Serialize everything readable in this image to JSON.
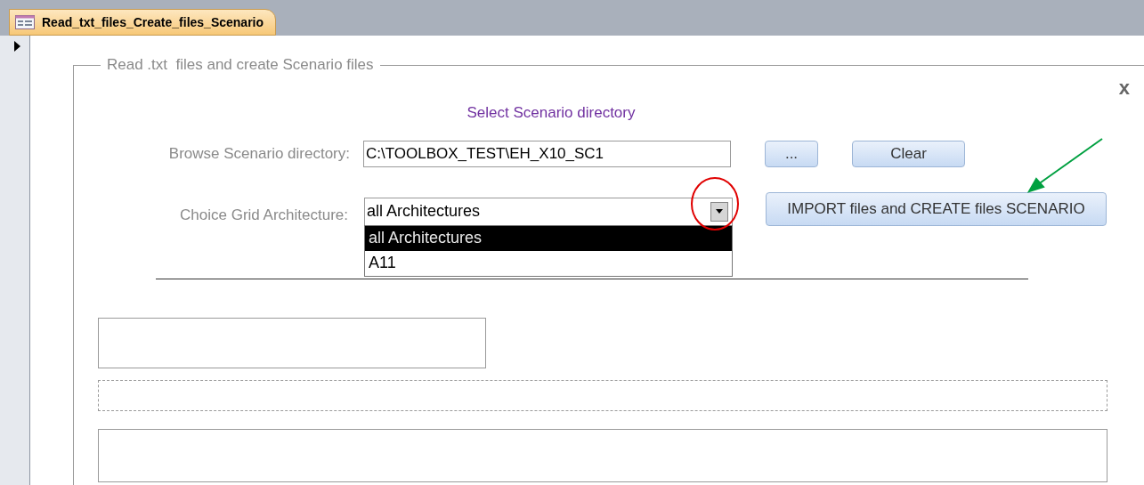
{
  "tab": {
    "title": "Read_txt_files_Create_files_Scenario",
    "selected": true
  },
  "form": {
    "legend": "Read .txt  files and create Scenario files",
    "close": "x",
    "heading": "Select Scenario directory",
    "directory": {
      "label": "Browse Scenario directory:",
      "value": "C:\\TOOLBOX_TEST\\EH_X10_SC1"
    },
    "browse_button": "...",
    "clear_button": "Clear",
    "architecture": {
      "label": "Choice Grid Architecture:",
      "value": "all Architectures",
      "expanded": true,
      "options": [
        {
          "label": "all Architectures",
          "selected": true
        },
        {
          "label": "A11",
          "selected": false
        }
      ]
    },
    "import_button": "IMPORT files and CREATE files SCENARIO"
  }
}
